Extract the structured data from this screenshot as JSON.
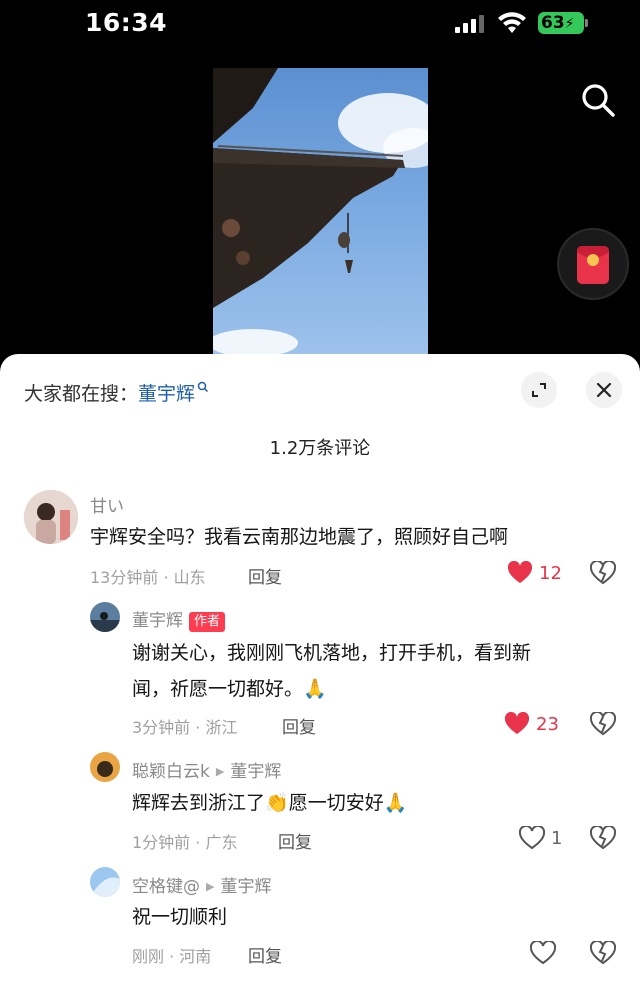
{
  "status": {
    "time": "16:34",
    "battery": "63"
  },
  "search_suggest": {
    "prefix": "大家都在搜：",
    "keyword": "董宇辉"
  },
  "comment_count": "1.2万条评论",
  "comments": [
    {
      "name": "甘い",
      "text": "宇辉安全吗？我看云南那边地震了，照顾好自己啊",
      "meta": "13分钟前 · 山东",
      "reply": "回复",
      "likes": "12",
      "liked": true
    },
    {
      "name": "董宇辉",
      "badge": "作者",
      "text_line1": "谢谢关心，我刚刚飞机落地，打开手机，看到新",
      "text_line2": "闻，祈愿一切都好。",
      "meta": "3分钟前 · 浙江",
      "reply": "回复",
      "likes": "23",
      "liked": true
    },
    {
      "name": "聪颖白云k",
      "reply_to": "董宇辉",
      "text_a": "辉辉去到浙江了",
      "text_b": "愿一切安好",
      "meta": "1分钟前 · 广东",
      "reply": "回复",
      "likes": "1",
      "liked": false
    },
    {
      "name": "空格键@",
      "reply_to": "董宇辉",
      "text": "祝一切顺利",
      "meta": "刚刚 · 河南",
      "reply": "回复",
      "likes": "",
      "liked": false
    }
  ],
  "icons": {
    "pray": "🙏",
    "clap": "👏"
  },
  "colors": {
    "like_red": "#e8334a",
    "link_blue": "#1f5fa8",
    "badge_red": "#ff3d52"
  }
}
